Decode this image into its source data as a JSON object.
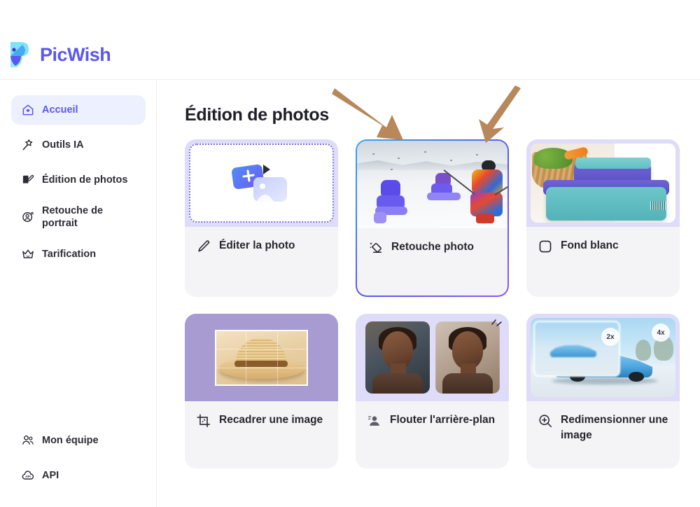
{
  "header": {
    "brand": "PicWish",
    "logo_icon": "picwish-bird-logo"
  },
  "sidebar": {
    "top_items": [
      {
        "label": "Accueil",
        "icon": "home-heart-icon",
        "active": true
      },
      {
        "label": "Outils IA",
        "icon": "magic-wand-icon",
        "active": false
      },
      {
        "label": "Édition de photos",
        "icon": "photo-edit-icon",
        "active": false
      },
      {
        "label": "Retouche de\nportrait",
        "icon": "portrait-retouch-icon",
        "active": false
      },
      {
        "label": "Tarification",
        "icon": "crown-icon",
        "active": false
      }
    ],
    "bottom_items": [
      {
        "label": "Mon équipe",
        "icon": "team-people-icon"
      },
      {
        "label": "API",
        "icon": "api-cloud-icon"
      }
    ]
  },
  "main": {
    "page_title": "Édition de photos",
    "cards": [
      {
        "label": "Éditer la photo",
        "icon": "pencil-icon",
        "thumb": "upload-dropzone",
        "selected": false
      },
      {
        "label": "Retouche photo",
        "icon": "eraser-sparkle-icon",
        "thumb": "ski-photo",
        "selected": true
      },
      {
        "label": "Fond blanc",
        "icon": "square-outline-icon",
        "thumb": "lunchbox-product-photo",
        "selected": false
      },
      {
        "label": "Recadrer une image",
        "icon": "crop-icon",
        "thumb": "straw-hat-crop-photo",
        "selected": false
      },
      {
        "label": "Flouter l'arrière-plan",
        "icon": "portrait-blur-icon",
        "thumb": "portrait-pair-photo",
        "selected": false
      },
      {
        "label": "Redimensionner une image",
        "icon": "zoom-in-icon",
        "thumb": "car-upscale-photo",
        "selected": false
      }
    ],
    "upscale_badges": {
      "small": "2x",
      "large": "4x"
    }
  },
  "annotations": {
    "arrow_color": "#B8875A",
    "arrows": [
      {
        "name": "arrow-pointing-to-retouche-card-left",
        "direction": "down-right"
      },
      {
        "name": "arrow-pointing-to-retouche-card-right",
        "direction": "down-left"
      }
    ]
  },
  "colors": {
    "accent_purple": "#5B57F0",
    "active_nav_bg": "#EDF0FE",
    "card_bg": "#F4F4F6",
    "thumb_lavender": "#DEDCF8",
    "text_dark": "#26262E"
  }
}
